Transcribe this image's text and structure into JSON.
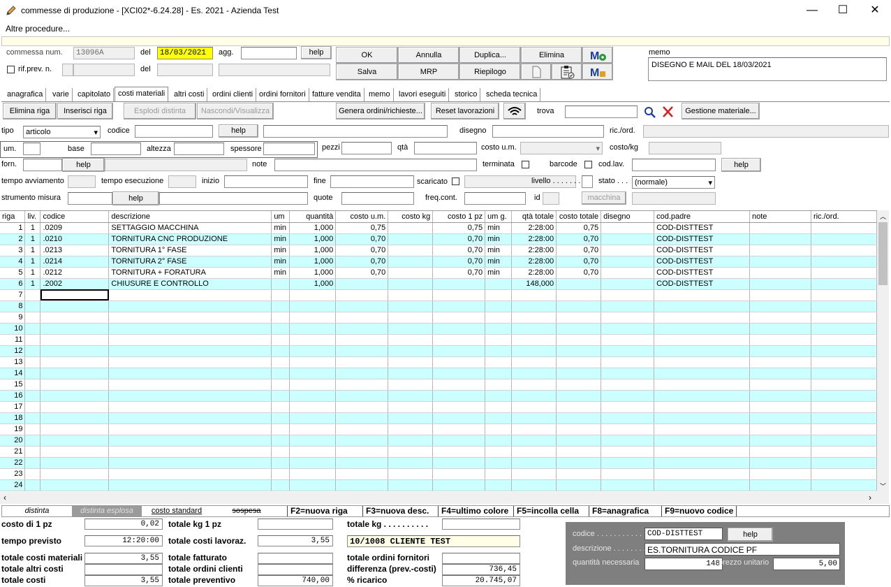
{
  "window": {
    "title": "commesse di produzione - [XCI02*-6.24.28] - Es. 2021 - Azienda Test",
    "minimize": "—",
    "maximize": "☐",
    "close": "✕"
  },
  "menu": {
    "altre": "Altre procedure..."
  },
  "header": {
    "commessa_label": "commessa num.",
    "commessa_value": "13096A",
    "del_label": "del",
    "del_value": "18/03/2021",
    "agg_label": "agg.",
    "help": "help",
    "rifprev_label": "rif.prev. n.",
    "del2_label": "del",
    "memo_label": "memo",
    "memo_value": "DISEGNO E MAIL DEL 18/03/2021"
  },
  "buttons": {
    "ok": "OK",
    "annulla": "Annulla",
    "duplica": "Duplica...",
    "elimina": "Elimina",
    "salva": "Salva",
    "mrp": "MRP",
    "riepilogo": "Riepilogo"
  },
  "tabs": [
    "anagrafica",
    "varie",
    "capitolato",
    "costi materiali",
    "altri costi",
    "ordini clienti",
    "ordini fornitori",
    "fatture vendita",
    "memo",
    "lavori eseguiti",
    "storico",
    "scheda tecnica"
  ],
  "toolbar": {
    "elimina_riga": "Elimina riga",
    "inserisci_riga": "Inserisci riga",
    "esplodi": "Esplodi distinta",
    "nascondi": "Nascondi/Visualizza",
    "genera": "Genera ordini/richieste...",
    "reset": "Reset lavorazioni",
    "trova": "trova",
    "gestione": "Gestione materiale..."
  },
  "form": {
    "tipo_label": "tipo",
    "tipo_value": "articolo",
    "codice_label": "codice",
    "help": "help",
    "disegno_label": "disegno",
    "ricord_label": "ric./ord.",
    "um_label": "um.",
    "base_label": "base",
    "altezza_label": "altezza",
    "spessore_label": "spessore",
    "pezzi_label": "pezzi",
    "qta_label": "qtà",
    "costoum_label": "costo u.m.",
    "costokg_label": "costo/kg",
    "forn_label": "forn.",
    "note_label": "note",
    "terminata_label": "terminata",
    "barcode_label": "barcode",
    "codlav_label": "cod.lav.",
    "tempo_avv_label": "tempo avviamento",
    "tempo_esec_label": "tempo esecuzione",
    "inizio_label": "inizio",
    "fine_label": "fine",
    "scaricato_label": "scaricato",
    "livello_label": "livello . . . . . . .",
    "stato_label": "stato . . .",
    "stato_value": "(normale)",
    "strumento_label": "strumento misura",
    "quote_label": "quote",
    "freqcont_label": "freq.cont.",
    "id_label": "id",
    "macchina": "macchina"
  },
  "table": {
    "headers": [
      "riga",
      "liv.",
      "codice",
      "descrizione",
      "um",
      "quantità",
      "costo u.m.",
      "costo kg",
      "costo 1 pz",
      "um g.",
      "qtà totale",
      "costo totale",
      "disegno",
      "cod.padre",
      "note",
      "ric./ord."
    ],
    "rows": [
      [
        "1",
        "1",
        ".0209",
        "SETTAGGIO MACCHINA",
        "min",
        "1,000",
        "0,75",
        "",
        "0,75",
        "min",
        "2:28:00",
        "0,75",
        "",
        "COD-DISTTEST",
        "",
        ""
      ],
      [
        "2",
        "1",
        ".0210",
        "TORNITURA CNC PRODUZIONE",
        "min",
        "1,000",
        "0,70",
        "",
        "0,70",
        "min",
        "2:28:00",
        "0,70",
        "",
        "COD-DISTTEST",
        "",
        ""
      ],
      [
        "3",
        "1",
        ".0213",
        "TORNITURA 1° FASE",
        "min",
        "1,000",
        "0,70",
        "",
        "0,70",
        "min",
        "2:28:00",
        "0,70",
        "",
        "COD-DISTTEST",
        "",
        ""
      ],
      [
        "4",
        "1",
        ".0214",
        "TORNITURA 2° FASE",
        "min",
        "1,000",
        "0,70",
        "",
        "0,70",
        "min",
        "2:28:00",
        "0,70",
        "",
        "COD-DISTTEST",
        "",
        ""
      ],
      [
        "5",
        "1",
        ".0212",
        "TORNITURA + FORATURA",
        "min",
        "1,000",
        "0,70",
        "",
        "0,70",
        "min",
        "2:28:00",
        "0,70",
        "",
        "COD-DISTTEST",
        "",
        ""
      ],
      [
        "6",
        "1",
        ".2002",
        "CHIUSURE E CONTROLLO",
        "",
        "1,000",
        "",
        "",
        "",
        "",
        "148,000",
        "",
        "",
        "COD-DISTTEST",
        "",
        ""
      ],
      [
        "7"
      ],
      [
        "8"
      ],
      [
        "9"
      ],
      [
        "10"
      ],
      [
        "11"
      ],
      [
        "12"
      ],
      [
        "13"
      ],
      [
        "14"
      ],
      [
        "15"
      ],
      [
        "16"
      ],
      [
        "17"
      ],
      [
        "18"
      ],
      [
        "19"
      ],
      [
        "20"
      ],
      [
        "21"
      ],
      [
        "22"
      ],
      [
        "23"
      ],
      [
        "24"
      ]
    ]
  },
  "status": {
    "distinta": "distinta",
    "distinta_esplosa": "distinta esplosa",
    "costo_standard": "costo standard",
    "sospesa": "sospesa",
    "f2": "F2=nuova riga",
    "f3": "F3=nuova desc.",
    "f4": "F4=ultimo colore",
    "f5": "F5=incolla cella",
    "f8": "F8=anagrafica",
    "f9": "F9=nuovo codice"
  },
  "totals": {
    "costo_1pz_label": "costo di 1 pz",
    "costo_1pz": "0,02",
    "tempo_label": "tempo previsto",
    "tempo": "12:20:00",
    "tot_mat_label": "totale costi materiali",
    "tot_mat": "3,55",
    "tot_altri_label": "totale altri costi",
    "tot_altri": "",
    "tot_costi_label": "totale costi",
    "tot_costi": "3,55",
    "kg1pz_label": "totale kg 1 pz",
    "lavoraz_label": "totale costi lavoraz.",
    "lavoraz": "3,55",
    "fatturato_label": "totale fatturato",
    "ordcli_label": "totale ordini clienti",
    "preventivo_label": "totale preventivo",
    "preventivo": "740,00",
    "totkg_label": "totale kg . . . . . . . . . .",
    "cliente": "10/1008 CLIENTE TEST",
    "ordforn_label": "totale ordini fornitori",
    "diff_label": "differenza (prev.-costi)",
    "diff": "736,45",
    "ricarico_label": "% ricarico",
    "ricarico": "20.745,07"
  },
  "panel": {
    "codice_label": "codice . . . . . . . . . . .",
    "codice": "COD-DISTTEST",
    "help": "help",
    "descr_label": "descrizione . . . . . . . .",
    "descr": "ES.TORNITURA CODICE PF",
    "qta_label": "quantità necessaria",
    "qta": "148",
    "prezzo_label": "prezzo unitario",
    "prezzo": "5,00"
  }
}
